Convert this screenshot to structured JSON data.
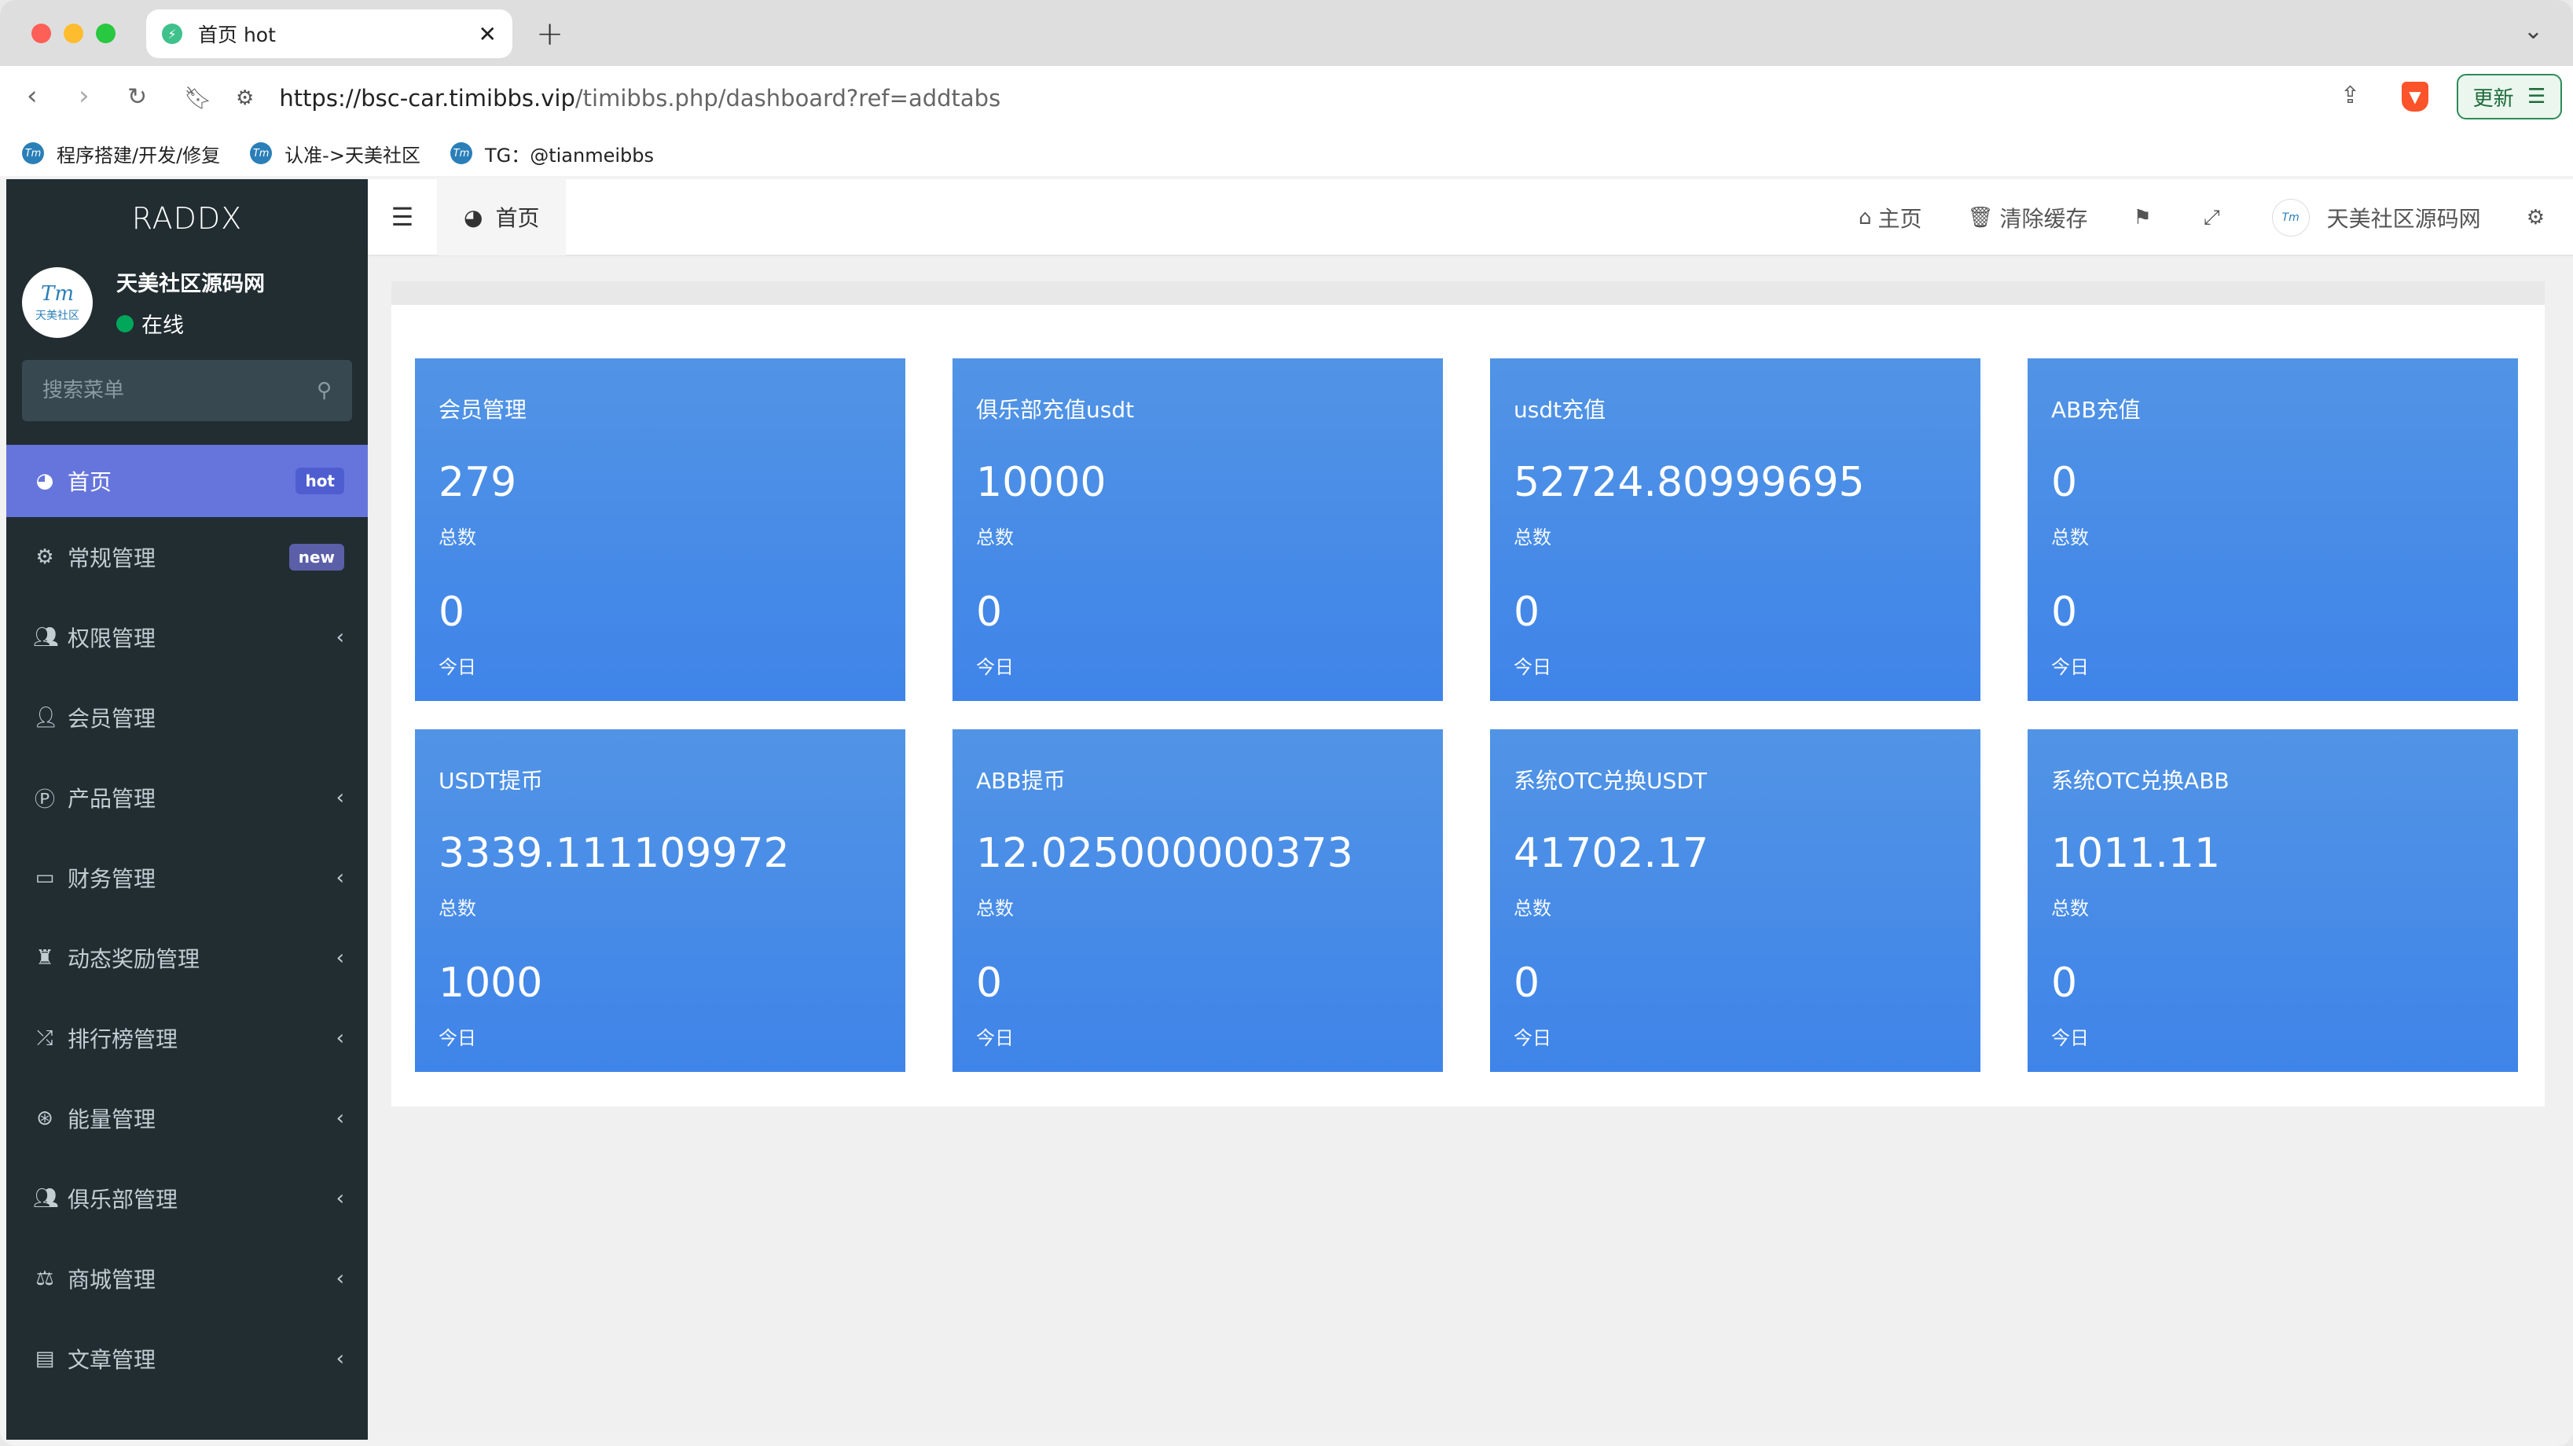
{
  "browser": {
    "tab_title": "首页 hot",
    "new_tab": "+",
    "url_host": "https://bsc-car.timibbs.vip",
    "url_path": "/timibbs.php/dashboard?ref=addtabs",
    "update_label": "更新",
    "bookmarks": [
      "程序搭建/开发/修复",
      "认准->天美社区",
      "TG：@tianmeibbs"
    ]
  },
  "sidebar": {
    "logo": "RADDX",
    "user_name": "天美社区源码网",
    "user_status": "在线",
    "avatar_text": "Tm",
    "avatar_sub": "天美社区",
    "search_placeholder": "搜索菜单",
    "items": [
      {
        "label": "首页",
        "icon": "dashboard-icon",
        "badge": "hot"
      },
      {
        "label": "常规管理",
        "icon": "cogs-icon",
        "badge": "new"
      },
      {
        "label": "权限管理",
        "icon": "users-icon"
      },
      {
        "label": "会员管理",
        "icon": "user-icon"
      },
      {
        "label": "产品管理",
        "icon": "product-icon"
      },
      {
        "label": "财务管理",
        "icon": "credit-card-icon"
      },
      {
        "label": "动态奖励管理",
        "icon": "beer-icon"
      },
      {
        "label": "排行榜管理",
        "icon": "random-icon"
      },
      {
        "label": "能量管理",
        "icon": "life-ring-icon"
      },
      {
        "label": "俱乐部管理",
        "icon": "users-icon"
      },
      {
        "label": "商城管理",
        "icon": "balance-scale-icon"
      },
      {
        "label": "文章管理",
        "icon": "newspaper-icon"
      }
    ]
  },
  "topbar": {
    "tab_label": "首页",
    "home_label": "主页",
    "clear_cache_label": "清除缓存",
    "user_name": "天美社区源码网"
  },
  "cards": [
    {
      "title": "会员管理",
      "total": "279",
      "total_label": "总数",
      "today": "0",
      "today_label": "今日"
    },
    {
      "title": "俱乐部充值usdt",
      "total": "10000",
      "total_label": "总数",
      "today": "0",
      "today_label": "今日"
    },
    {
      "title": "usdt充值",
      "total": "52724.80999695",
      "total_label": "总数",
      "today": "0",
      "today_label": "今日"
    },
    {
      "title": "ABB充值",
      "total": "0",
      "total_label": "总数",
      "today": "0",
      "today_label": "今日"
    },
    {
      "title": "USDT提币",
      "total": "3339.111109972",
      "total_label": "总数",
      "today": "1000",
      "today_label": "今日"
    },
    {
      "title": "ABB提币",
      "total": "12.025000000373",
      "total_label": "总数",
      "today": "0",
      "today_label": "今日"
    },
    {
      "title": "系统OTC兑换USDT",
      "total": "41702.17",
      "total_label": "总数",
      "today": "0",
      "today_label": "今日"
    },
    {
      "title": "系统OTC兑换ABB",
      "total": "1011.11",
      "total_label": "总数",
      "today": "0",
      "today_label": "今日"
    }
  ],
  "colors": {
    "sidebar_bg": "#222d32",
    "active_item": "#6675dc",
    "card_blue": "#4a8ee7"
  }
}
